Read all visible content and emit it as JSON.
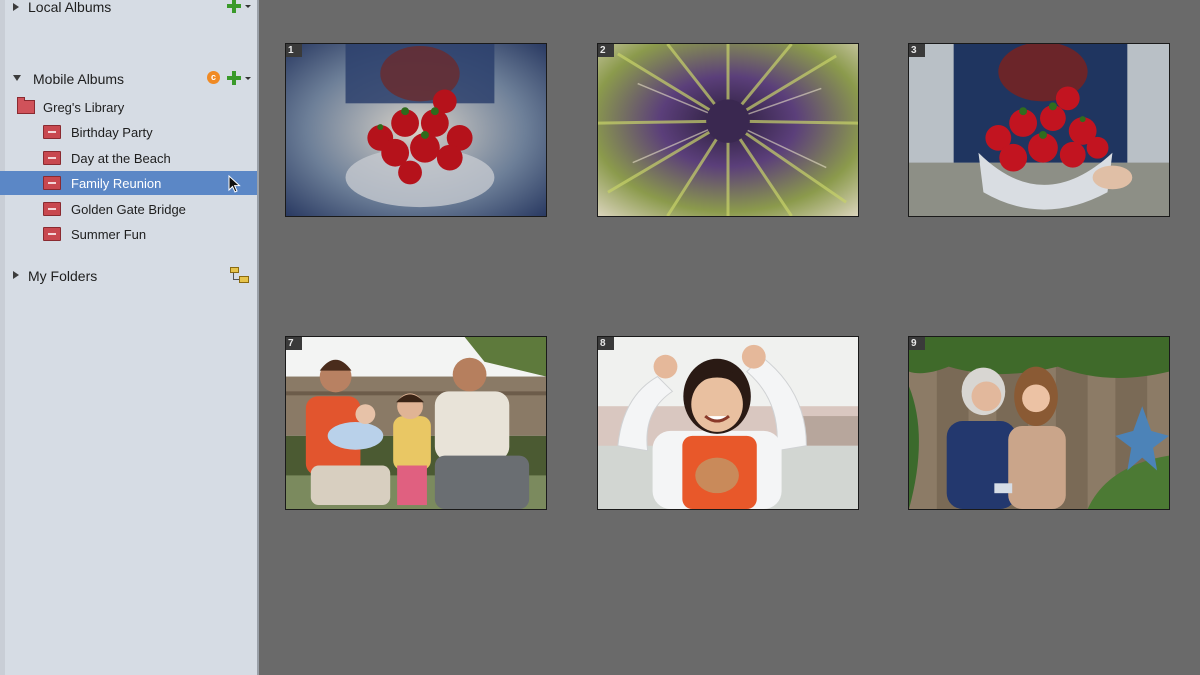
{
  "sidebar": {
    "local_albums": {
      "label": "Local Albums"
    },
    "mobile_albums": {
      "label": "Mobile Albums",
      "library": {
        "label": "Greg's Library"
      },
      "items": [
        {
          "label": "Birthday Party",
          "selected": false
        },
        {
          "label": "Day at the Beach",
          "selected": false
        },
        {
          "label": "Family Reunion",
          "selected": true
        },
        {
          "label": "Golden Gate Bridge",
          "selected": false
        },
        {
          "label": "Summer Fun",
          "selected": false
        }
      ]
    },
    "my_folders": {
      "label": "My Folders"
    }
  },
  "grid": {
    "thumbnails": [
      {
        "number": "1",
        "subject": "strawberries-bowl-zoom-blur"
      },
      {
        "number": "2",
        "subject": "flower-zoom-blur"
      },
      {
        "number": "3",
        "subject": "strawberries-bowl"
      },
      {
        "number": "7",
        "subject": "family-on-bench"
      },
      {
        "number": "8",
        "subject": "girl-flexing"
      },
      {
        "number": "9",
        "subject": "two-women-garden"
      }
    ]
  },
  "colors": {
    "sidebar_bg": "#d6dce4",
    "selection": "#5b87c6",
    "grid_bg": "#6a6a6a",
    "album_icon": "#c8484f",
    "add_icon": "#3a9a2a",
    "sync_icon": "#f08a24"
  },
  "icons": [
    "disclosure-triangle-icon",
    "add-icon",
    "sync-icon",
    "album-icon",
    "folder-icon",
    "folder-tree-icon",
    "mouse-cursor-icon"
  ]
}
